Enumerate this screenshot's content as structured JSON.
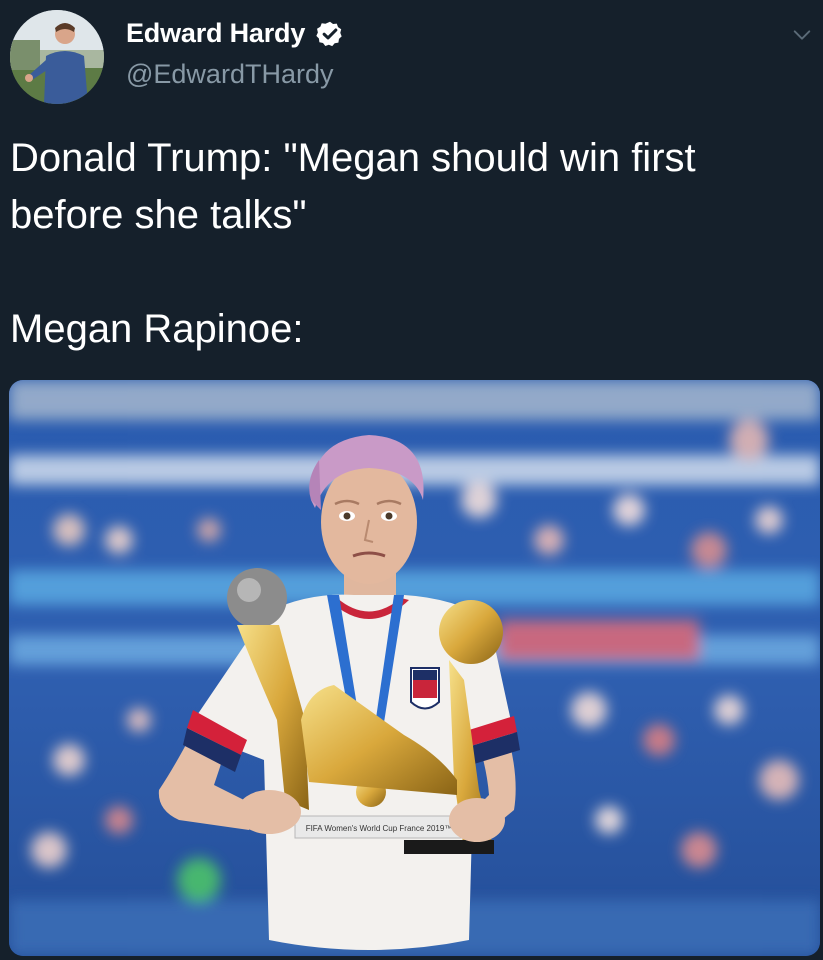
{
  "tweet": {
    "author": {
      "display_name": "Edward Hardy",
      "handle": "@EdwardTHardy",
      "verified": true,
      "avatar_icon": "profile-photo"
    },
    "text": "Donald Trump: \"Megan should win first before she talks\"\n\nMegan Rapinoe:",
    "media": {
      "type": "photo",
      "trophy_plaque_text": "FIFA Women's World Cup France 2019™"
    }
  },
  "colors": {
    "background": "#15202b",
    "text": "#ffffff",
    "secondary_text": "#8899a6",
    "verified_badge": "#ffffff"
  }
}
